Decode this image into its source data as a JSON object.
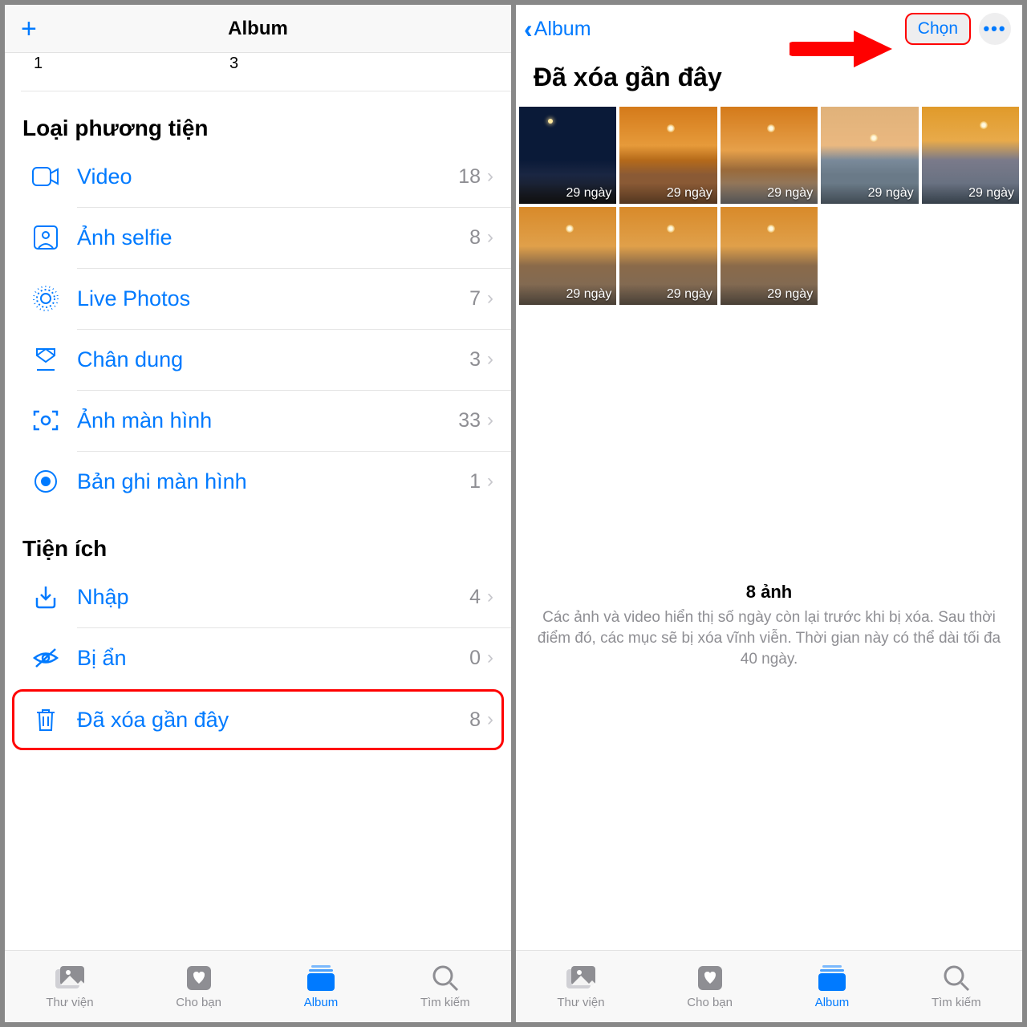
{
  "left": {
    "header_title": "Album",
    "stub1": "1",
    "stub3": "3",
    "section1_title": "Loại phương tiện",
    "media_rows": [
      {
        "icon": "video",
        "label": "Video",
        "count": "18"
      },
      {
        "icon": "selfie",
        "label": "Ảnh selfie",
        "count": "8"
      },
      {
        "icon": "live",
        "label": "Live Photos",
        "count": "7"
      },
      {
        "icon": "portrait",
        "label": "Chân dung",
        "count": "3"
      },
      {
        "icon": "screenshot",
        "label": "Ảnh màn hình",
        "count": "33"
      },
      {
        "icon": "recording",
        "label": "Bản ghi màn hình",
        "count": "1"
      }
    ],
    "section2_title": "Tiện ích",
    "util_rows": [
      {
        "icon": "import",
        "label": "Nhập",
        "count": "4"
      },
      {
        "icon": "hidden",
        "label": "Bị ẩn",
        "count": "0"
      },
      {
        "icon": "trash",
        "label": "Đã xóa gần đây",
        "count": "8"
      }
    ],
    "tabs": [
      "Thư viện",
      "Cho bạn",
      "Album",
      "Tìm kiếm"
    ]
  },
  "right": {
    "back_label": "Album",
    "select_label": "Chọn",
    "title": "Đã xóa gần đây",
    "thumb_label": "29 ngày",
    "count_line": "8 ảnh",
    "desc": "Các ảnh và video hiển thị số ngày còn lại trước khi bị xóa. Sau thời điểm đó, các mục sẽ bị xóa vĩnh viễn. Thời gian này có thể dài tối đa 40 ngày.",
    "tabs": [
      "Thư viện",
      "Cho bạn",
      "Album",
      "Tìm kiếm"
    ]
  }
}
